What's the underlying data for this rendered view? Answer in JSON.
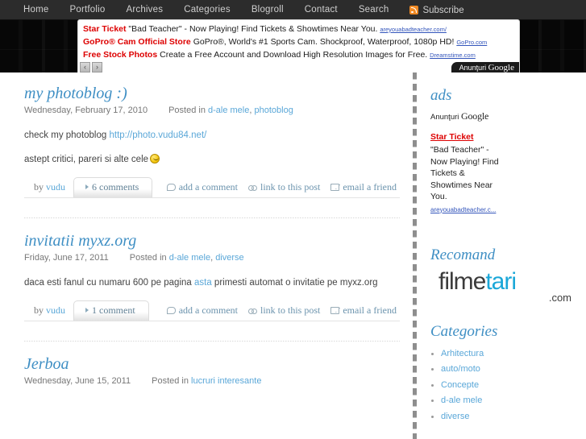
{
  "nav": {
    "items": [
      "Home",
      "Portfolio",
      "Archives",
      "Categories",
      "Blogroll",
      "Contact",
      "Search"
    ],
    "subscribe_label": "Subscribe",
    "subscribe_icon": "rss-icon"
  },
  "top_ad": {
    "lines": [
      {
        "title": "Star Ticket",
        "desc": "\"Bad Teacher\" - Now Playing! Find Tickets & Showtimes Near You.",
        "url": "areyouabadteacher.com/"
      },
      {
        "title": "GoPro® Cam Official Store",
        "desc": "GoPro®, World's #1 Sports Cam. Shockproof, Waterproof, 1080p HD!",
        "url": "GoPro.com"
      },
      {
        "title": "Free Stock Photos",
        "desc": "Create a Free Account and Download High Resolution Images for Free.",
        "url": "Dreamstime.com"
      }
    ],
    "prev_label": "‹",
    "next_label": "›",
    "brand_prefix": "Anunţuri ",
    "brand_logo": "Google"
  },
  "posts": [
    {
      "title": "my photoblog :)",
      "date": "Wednesday, February 17, 2010",
      "posted_in_label": "Posted in ",
      "categories": [
        "d-ale mele",
        "photoblog"
      ],
      "body_lead": "check my photoblog  ",
      "body_link": "http://photo.vudu84.net/",
      "body_second": "astept critici, pareri si alte cele",
      "has_smiley": true,
      "by_label": "by ",
      "author": "vudu",
      "comments_label": "6 comments"
    },
    {
      "title": "invitatii myxz.org",
      "date": "Friday, June 17, 2011",
      "posted_in_label": "Posted in ",
      "categories": [
        "d-ale mele",
        "diverse"
      ],
      "body_pre": "daca esti fanul cu numaru 600 pe pagina ",
      "body_link": "asta",
      "body_post": " primesti automat o invitatie pe myxz.org",
      "by_label": "by ",
      "author": "vudu",
      "comments_label": "1 comment"
    },
    {
      "title": "Jerboa",
      "date": "Wednesday, June 15, 2011",
      "posted_in_label": "Posted in ",
      "categories": [
        "lucruri interesante"
      ]
    }
  ],
  "post_actions": [
    {
      "label": "add a comment",
      "icon": "comment-bubble-icon"
    },
    {
      "label": "link to this post",
      "icon": "link-icon"
    },
    {
      "label": "email a friend",
      "icon": "envelope-icon"
    }
  ],
  "sidebar": {
    "ads_title": "ads",
    "anunturi_prefix": "Anunţuri ",
    "anunturi_logo": "Google",
    "ad": {
      "title": "Star Ticket",
      "desc": "\"Bad Teacher\" - Now Playing! Find Tickets & Showtimes Near You.",
      "url": "areyouabadteacher.c..."
    },
    "recomand_title": "Recomand",
    "logo": {
      "part1": "filme",
      "part2": "tari",
      "tld": ".com"
    },
    "categories_title": "Categories",
    "categories": [
      "Arhitectura",
      "auto/moto",
      "Concepte",
      "d-ale mele",
      "diverse"
    ]
  },
  "colors": {
    "nav_bg": "#2c2c2c",
    "accent_blue": "#3f8fc4",
    "link_blue": "#5aa7d8",
    "ad_red": "#dd0000",
    "logo_cyan": "#1aa7d8"
  }
}
